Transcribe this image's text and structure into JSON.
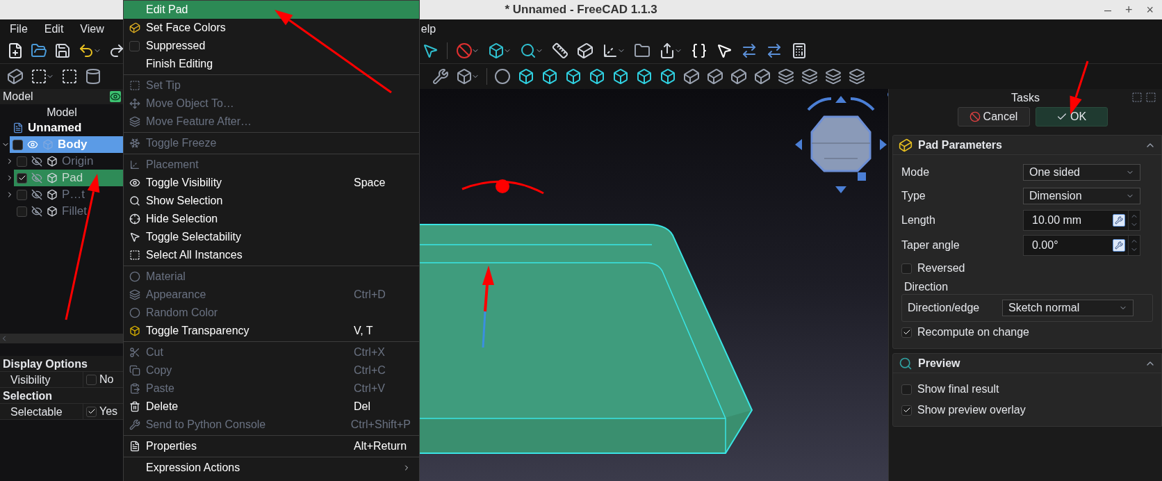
{
  "window": {
    "title": "* Unnamed - FreeCAD 1.1.3",
    "controls": [
      "–",
      "+",
      "×"
    ]
  },
  "menu_bar": [
    "File",
    "Edit",
    "View",
    "elp"
  ],
  "model_panel": {
    "title": "Model",
    "tree_header": "Model",
    "tree": [
      {
        "label": "Unnamed",
        "selected": false,
        "children": [
          {
            "label": "Body",
            "expanded": true,
            "checked": false,
            "visible": true,
            "selected": true,
            "color": "#5b9be6",
            "children": [
              {
                "label": "Origin",
                "expanded": false,
                "checked": false,
                "visible": false,
                "selected": false
              },
              {
                "label": "Pad",
                "expanded": false,
                "checked": true,
                "visible": false,
                "selected": true,
                "color": "#2e8b57"
              },
              {
                "label": "P…t",
                "expanded": false,
                "checked": false,
                "visible": false,
                "selected": false
              },
              {
                "label": "Fillet",
                "checked": false,
                "visible": false,
                "selected": false
              }
            ]
          }
        ]
      }
    ]
  },
  "properties": {
    "groups": [
      {
        "title": "Display Options",
        "rows": [
          {
            "name": "Visibility",
            "value": "No",
            "checked": false
          }
        ]
      },
      {
        "title": "Selection",
        "rows": [
          {
            "name": "Selectable",
            "value": "Yes",
            "checked": true
          }
        ]
      }
    ]
  },
  "context_menu": {
    "items": [
      {
        "kind": "item",
        "label": "Edit Pad",
        "selected": true,
        "disabled": false
      },
      {
        "kind": "item",
        "label": "Set Face Colors",
        "selected": false,
        "disabled": false
      },
      {
        "kind": "checkbox",
        "label": "Suppressed",
        "checked": false,
        "selected": false,
        "disabled": false
      },
      {
        "kind": "item",
        "label": "Finish Editing",
        "selected": false,
        "disabled": false
      },
      {
        "kind": "separator"
      },
      {
        "kind": "item",
        "label": "Set Tip",
        "selected": false,
        "disabled": true
      },
      {
        "kind": "item",
        "label": "Move Object To…",
        "selected": false,
        "disabled": true
      },
      {
        "kind": "item",
        "label": "Move Feature After…",
        "selected": false,
        "disabled": true
      },
      {
        "kind": "separator"
      },
      {
        "kind": "item",
        "label": "Toggle Freeze",
        "selected": false,
        "disabled": true
      },
      {
        "kind": "separator"
      },
      {
        "kind": "item",
        "label": "Placement",
        "selected": false,
        "disabled": true
      },
      {
        "kind": "item",
        "label": "Toggle Visibility",
        "shortcut": "Space",
        "selected": false,
        "disabled": false
      },
      {
        "kind": "item",
        "label": "Show Selection",
        "selected": false,
        "disabled": false
      },
      {
        "kind": "item",
        "label": "Hide Selection",
        "selected": false,
        "disabled": false
      },
      {
        "kind": "item",
        "label": "Toggle Selectability",
        "selected": false,
        "disabled": false
      },
      {
        "kind": "item",
        "label": "Select All Instances",
        "selected": false,
        "disabled": false
      },
      {
        "kind": "separator"
      },
      {
        "kind": "item",
        "label": "Material",
        "selected": false,
        "disabled": true
      },
      {
        "kind": "item",
        "label": "Appearance",
        "shortcut": "Ctrl+D",
        "selected": false,
        "disabled": true
      },
      {
        "kind": "item",
        "label": "Random Color",
        "selected": false,
        "disabled": true
      },
      {
        "kind": "item",
        "label": "Toggle Transparency",
        "shortcut": "V, T",
        "selected": false,
        "disabled": false
      },
      {
        "kind": "separator"
      },
      {
        "kind": "item",
        "label": "Cut",
        "shortcut": "Ctrl+X",
        "selected": false,
        "disabled": true
      },
      {
        "kind": "item",
        "label": "Copy",
        "shortcut": "Ctrl+C",
        "selected": false,
        "disabled": true
      },
      {
        "kind": "item",
        "label": "Paste",
        "shortcut": "Ctrl+V",
        "selected": false,
        "disabled": true
      },
      {
        "kind": "item",
        "label": "Delete",
        "shortcut": "Del",
        "selected": false,
        "disabled": false
      },
      {
        "kind": "item",
        "label": "Send to Python Console",
        "shortcut": "Ctrl+Shift+P",
        "selected": false,
        "disabled": true
      },
      {
        "kind": "separator"
      },
      {
        "kind": "item",
        "label": "Properties",
        "shortcut": "Alt+Return",
        "selected": false,
        "disabled": false
      },
      {
        "kind": "separator"
      },
      {
        "kind": "submenu",
        "label": "Expression Actions",
        "selected": false,
        "disabled": false
      }
    ]
  },
  "tasks": {
    "title": "Tasks",
    "buttons": [
      {
        "kind": "cancel",
        "label": "Cancel"
      },
      {
        "kind": "ok",
        "label": "OK"
      }
    ],
    "sections": [
      {
        "title": "Pad Parameters",
        "kind": "pad",
        "rows": [
          {
            "kind": "select",
            "label": "Mode",
            "value": "One sided"
          },
          {
            "kind": "select",
            "label": "Type",
            "value": "Dimension"
          },
          {
            "kind": "spin",
            "label": "Length",
            "value": "10.00 mm"
          },
          {
            "kind": "spin",
            "label": "Taper angle",
            "value": "0.00°"
          },
          {
            "kind": "checkbox",
            "label": "Reversed",
            "checked": false
          },
          {
            "kind": "group",
            "label": "Direction",
            "rows": [
              {
                "kind": "select",
                "label": "Direction/edge",
                "value": "Sketch normal"
              }
            ]
          },
          {
            "kind": "checkbox",
            "label": "Recompute on change",
            "checked": true
          }
        ]
      },
      {
        "title": "Preview",
        "kind": "preview",
        "rows": [
          {
            "kind": "checkbox",
            "label": "Show final result",
            "checked": false
          },
          {
            "kind": "checkbox",
            "label": "Show preview overlay",
            "checked": true
          }
        ]
      }
    ]
  }
}
